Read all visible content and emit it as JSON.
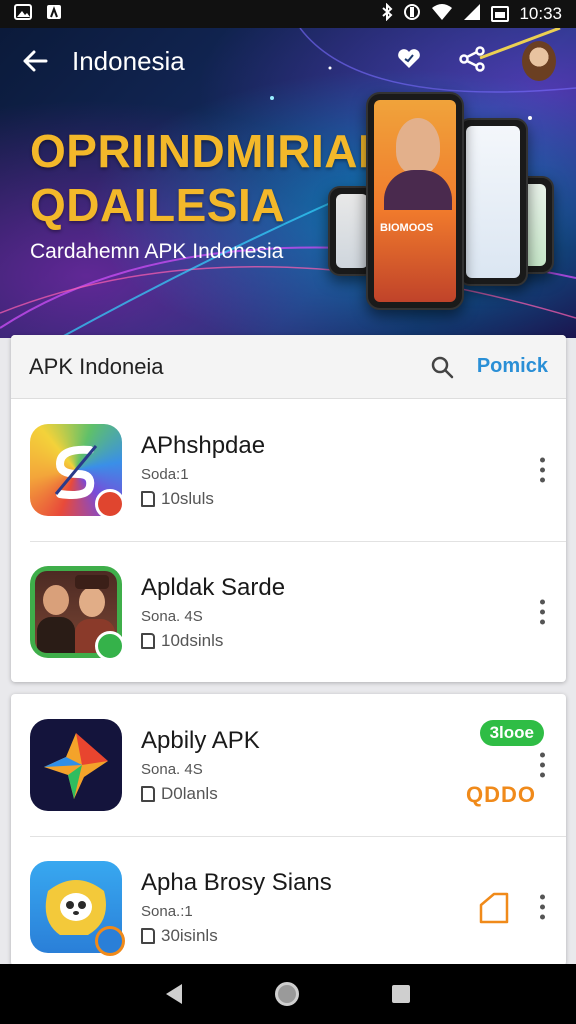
{
  "status_bar": {
    "time": "10:33",
    "left_icons": [
      "gallery-icon",
      "app-icon"
    ],
    "right_icons": [
      "bluetooth-icon",
      "nfc-icon",
      "wifi-icon",
      "signal-icon",
      "battery-icon"
    ]
  },
  "header": {
    "title": "Indonesia",
    "icons": [
      "back-arrow-icon",
      "heart-icon",
      "share-icon",
      "avatar"
    ]
  },
  "hero": {
    "title_line1": "OPRIINDMIRIAR",
    "title_line2": "QDAILESIA",
    "subtitle": "Cardahemn APK Indonesia",
    "phone_text": "BIOMOOS"
  },
  "list_card": {
    "title": "APK Indoneia",
    "link_label": "Pomick",
    "apps": [
      {
        "name": "APhshpdae",
        "sub": "Soda:1",
        "size": "10sluls"
      },
      {
        "name": "Apldak Sarde",
        "sub": "Sona. 4S",
        "size": "10dsinls"
      }
    ]
  },
  "list_card_2": {
    "apps": [
      {
        "name": "Apbily APK",
        "sub": "Sona. 4S",
        "size": "D0lanls",
        "badge": "3looe",
        "tag": "QDDO"
      },
      {
        "name": "Apha Brosy Sians",
        "sub": "Sona.:1",
        "size": "30isinls"
      }
    ]
  },
  "colors": {
    "accent_blue": "#2a8fd6",
    "hero_title": "#f3b82a",
    "badge_green": "#2fbd45",
    "orange": "#f08a1a"
  }
}
